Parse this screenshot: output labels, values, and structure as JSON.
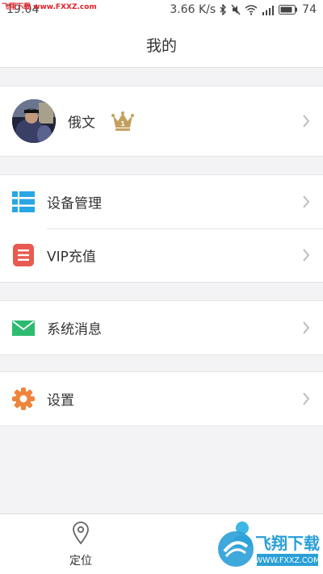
{
  "status_bar": {
    "time": "19:04",
    "watermark_url": "飞翔下载 www.FXXZ.com",
    "network_speed": "3.66 K/s",
    "battery": "74"
  },
  "header": {
    "title": "我的"
  },
  "profile": {
    "name": "俄文"
  },
  "menu": {
    "device": "设备管理",
    "vip": "VIP充值",
    "messages": "系统消息",
    "settings": "设置"
  },
  "tabs": [
    {
      "label": "定位",
      "icon": "location-pin-icon"
    },
    {
      "label": "",
      "icon": "person-icon"
    }
  ],
  "watermark": {
    "brand": "飞翔下载",
    "url": "WWW.FXXZ.COM"
  },
  "colors": {
    "device_icon": "#29a6e4",
    "vip_icon": "#e85a4f",
    "messages_icon": "#2dbb72",
    "settings_icon": "#f0843a",
    "crown": "#c4a05f",
    "active_tab": "#3fb6e6"
  }
}
